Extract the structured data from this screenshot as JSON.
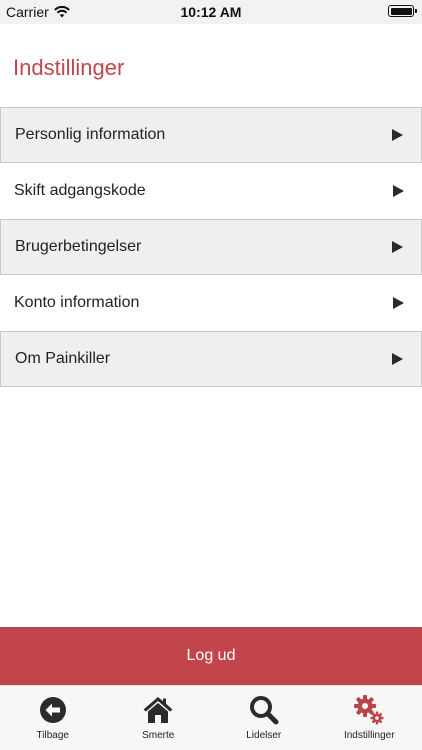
{
  "status_bar": {
    "carrier": "Carrier",
    "time": "10:12 AM"
  },
  "header": {
    "title": "Indstillinger"
  },
  "menu": {
    "items": [
      {
        "label": "Personlig information"
      },
      {
        "label": "Skift adgangskode"
      },
      {
        "label": "Brugerbetingelser"
      },
      {
        "label": "Konto information"
      },
      {
        "label": "Om Painkiller"
      }
    ]
  },
  "logout": {
    "label": "Log ud"
  },
  "tab_bar": {
    "tabs": [
      {
        "label": "Tilbage",
        "icon": "back-arrow-icon"
      },
      {
        "label": "Smerte",
        "icon": "home-icon"
      },
      {
        "label": "Lidelser",
        "icon": "search-icon"
      },
      {
        "label": "Indstillinger",
        "icon": "gears-icon"
      }
    ]
  },
  "colors": {
    "accent": "#c2454b",
    "title": "#c0484c",
    "row_shaded": "#f0eeef"
  }
}
